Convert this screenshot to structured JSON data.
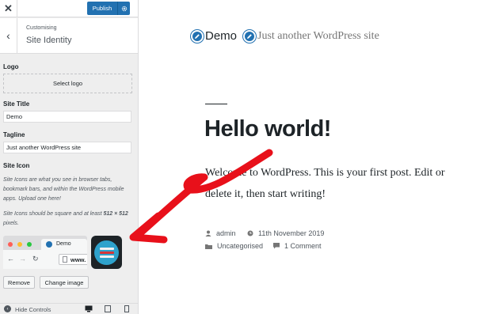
{
  "topbar": {
    "publish_label": "Publish"
  },
  "section": {
    "crumb": "Customising",
    "title": "Site Identity"
  },
  "logo": {
    "label": "Logo",
    "select_label": "Select logo"
  },
  "site_title": {
    "label": "Site Title",
    "value": "Demo"
  },
  "tagline": {
    "label": "Tagline",
    "value": "Just another WordPress site"
  },
  "site_icon": {
    "label": "Site Icon",
    "description_1": "Site Icons are what you see in browser tabs, bookmark bars, and within the WordPress mobile apps. Upload one here!",
    "description_2_prefix": "Site Icons should be square and at least ",
    "description_2_size": "512 × 512",
    "description_2_suffix": " pixels.",
    "browser_tab_label": "Demo",
    "browser_url": "www.",
    "remove_label": "Remove",
    "change_label": "Change image"
  },
  "footer": {
    "hide_controls_label": "Hide Controls"
  },
  "preview": {
    "site_title": "Demo",
    "site_tagline": "Just another WordPress site",
    "post_title": "Hello world!",
    "post_body": "Welcome to WordPress. This is your first post. Edit or delete it, then start writing!",
    "meta": {
      "author": "admin",
      "date": "11th November 2019",
      "category": "Uncategorised",
      "comments": "1 Comment"
    }
  },
  "colors": {
    "accent": "#2271b1",
    "arrow": "#e8101a",
    "dot_red": "#ff5f57",
    "dot_yellow": "#febc2e",
    "dot_green": "#28c840"
  },
  "icons": [
    "close-icon",
    "gear-icon",
    "back-chevron-icon",
    "pencil-icon",
    "browser-back-icon",
    "browser-forward-icon",
    "reload-icon",
    "page-icon",
    "site-icon-image",
    "hide-controls-icon",
    "desktop-icon",
    "tablet-icon",
    "mobile-icon",
    "person-icon",
    "clock-icon",
    "folder-icon",
    "comment-icon"
  ]
}
